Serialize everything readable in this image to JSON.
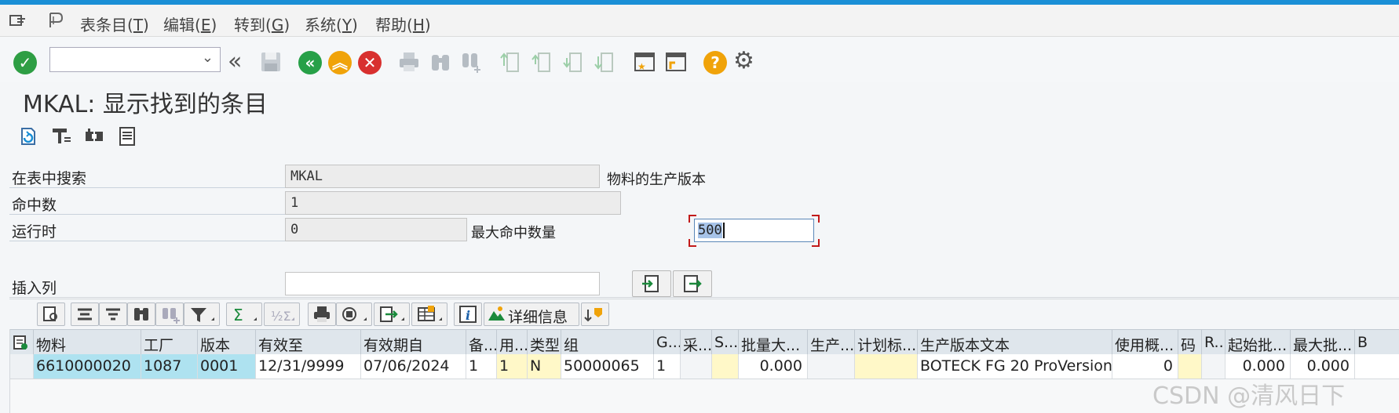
{
  "menu": {
    "items": [
      {
        "label": "表条目(",
        "key": "T",
        "suffix": ")"
      },
      {
        "label": "编辑(",
        "key": "E",
        "suffix": ")"
      },
      {
        "label": "转到(",
        "key": "G",
        "suffix": ")"
      },
      {
        "label": "系统(",
        "key": "Y",
        "suffix": ")"
      },
      {
        "label": "帮助(",
        "key": "H",
        "suffix": ")"
      }
    ]
  },
  "toolbar": {
    "command_value": ""
  },
  "page": {
    "title": "MKAL: 显示找到的条目"
  },
  "form": {
    "search_label": "在表中搜索",
    "search_value": "MKAL",
    "search_desc": "物料的生产版本",
    "hits_label": "命中数",
    "hits_value": "1",
    "runtime_label": "运行时",
    "runtime_value": "0",
    "maxhits_label": "最大命中数量",
    "maxhits_value": "500",
    "insert_label": "插入列",
    "insert_value": ""
  },
  "alv": {
    "detail_label": "详细信息"
  },
  "grid": {
    "headers": [
      "物料",
      "工厂",
      "版本",
      "有效至",
      "有效期自",
      "备...",
      "用...",
      "类型",
      "组",
      "G...",
      "采...",
      "S...",
      "批量大...",
      "生产...",
      "计划标...",
      "生产版本文本",
      "使用概...",
      "码",
      "R...",
      "起始批...",
      "最大批...",
      "B"
    ],
    "row": [
      "6610000020",
      "1087",
      "0001",
      "12/31/9999",
      "07/06/2024",
      "1",
      "1",
      "N",
      "50000065",
      "1",
      "",
      "",
      "0.000",
      "",
      "",
      "BOTECK FG 20 ProVersion",
      "0",
      "",
      "",
      "0.000",
      "0.000",
      ""
    ]
  },
  "watermark": "CSDN @清风日下",
  "colors": {
    "accent": "#1a8fd6",
    "ok": "#2e9e44",
    "nav_green": "#27a048",
    "nav_orange": "#f0a30a",
    "cancel": "#d8302f",
    "help": "#f0a30a",
    "key_cell": "#aee2f0",
    "input_cell": "#fff8c8"
  }
}
